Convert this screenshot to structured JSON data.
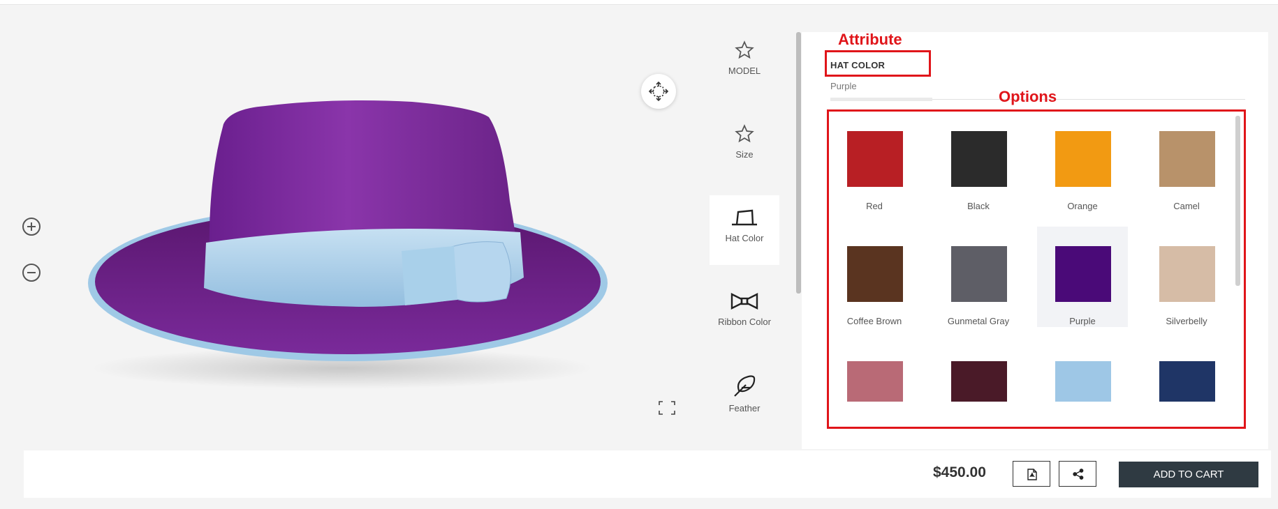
{
  "viewer": {
    "zoom_in_icon": "zoom-in-icon",
    "zoom_out_icon": "zoom-out-icon",
    "rotate_icon": "rotate-3d-icon",
    "fullscreen_icon": "fullscreen-icon",
    "hat_body_color": "#7a2a9a",
    "ribbon_color": "#a7cde8"
  },
  "nav": {
    "items": [
      {
        "label": "MODEL",
        "icon": "star-icon"
      },
      {
        "label": "Size",
        "icon": "star-icon"
      },
      {
        "label": "Hat Color",
        "icon": "hat-icon",
        "active": true
      },
      {
        "label": "Ribbon Color",
        "icon": "bow-tie-icon"
      },
      {
        "label": "Feather",
        "icon": "feather-icon"
      }
    ]
  },
  "panel": {
    "annotation_attribute": "Attribute",
    "annotation_options": "Options",
    "attribute_name": "HAT COLOR",
    "attribute_value": "Purple",
    "options": [
      {
        "name": "Red",
        "color": "#b81f24"
      },
      {
        "name": "Black",
        "color": "#2b2b2b"
      },
      {
        "name": "Orange",
        "color": "#f29a12"
      },
      {
        "name": "Camel",
        "color": "#b8926a"
      },
      {
        "name": "Coffee Brown",
        "color": "#5a3420"
      },
      {
        "name": "Gunmetal Gray",
        "color": "#5e5e66"
      },
      {
        "name": "Purple",
        "color": "#4a0a78",
        "selected": true
      },
      {
        "name": "Silverbelly",
        "color": "#d6bca6"
      },
      {
        "name": "",
        "color": "#b96a76"
      },
      {
        "name": "",
        "color": "#4a1a28"
      },
      {
        "name": "",
        "color": "#9ec7e6"
      },
      {
        "name": "",
        "color": "#1f3566"
      }
    ]
  },
  "footer": {
    "price": "$450.00",
    "pdf_icon": "pdf-icon",
    "share_icon": "share-icon",
    "add_to_cart": "ADD TO CART"
  }
}
